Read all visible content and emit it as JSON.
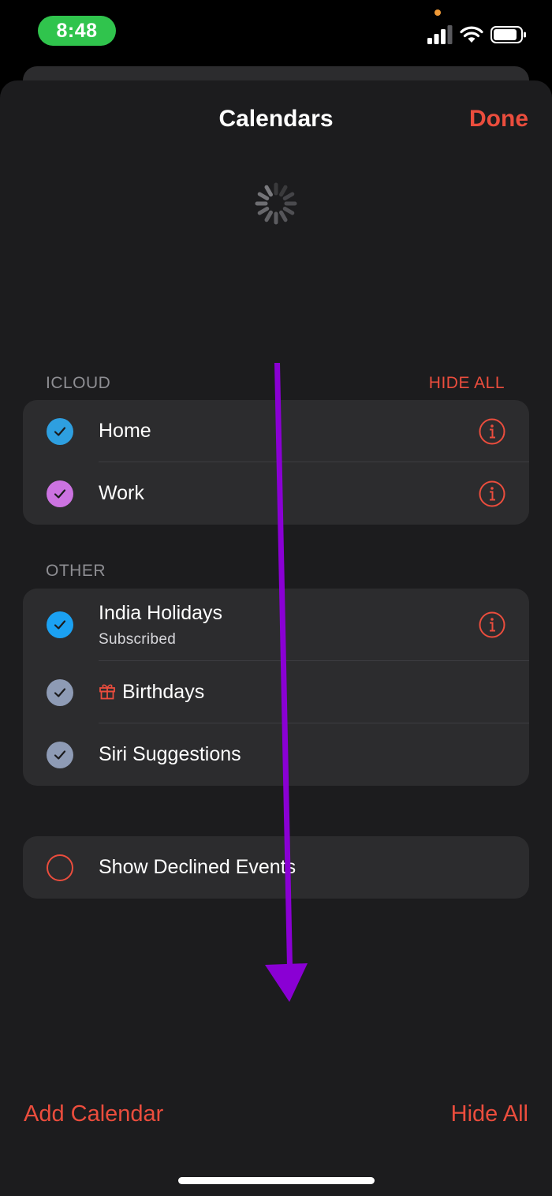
{
  "status_bar": {
    "time": "8:48",
    "icons": [
      "signal-icon",
      "wifi-icon",
      "battery-icon"
    ]
  },
  "nav": {
    "title": "Calendars",
    "done_label": "Done"
  },
  "loading_indicator": "spinner-icon",
  "sections": {
    "icloud": {
      "header": "ICLOUD",
      "hide_all_label": "HIDE ALL",
      "items": [
        {
          "name": "Home",
          "color": "#2e9fe0",
          "checked": true,
          "info": true
        },
        {
          "name": "Work",
          "color": "#cc73e1",
          "checked": true,
          "info": true
        }
      ]
    },
    "other": {
      "header": "OTHER",
      "items": [
        {
          "name": "India Holidays",
          "subtitle": "Subscribed",
          "color": "#1ba1f2",
          "checked": true,
          "info": true
        },
        {
          "name": "Birthdays",
          "color": "#8e9bb5",
          "checked": true,
          "icon": "gift-icon"
        },
        {
          "name": "Siri Suggestions",
          "color": "#8e9bb5",
          "checked": true
        }
      ]
    },
    "declined": {
      "label": "Show Declined Events",
      "checked": false
    }
  },
  "bottom_bar": {
    "add_calendar_label": "Add Calendar",
    "hide_all_label": "Hide All"
  },
  "colors": {
    "accent": "#eb4d3d",
    "background": "#1c1c1e",
    "group_background": "#2c2c2e",
    "annotation_arrow": "#8a00d4"
  },
  "annotation": "down-arrow-icon"
}
